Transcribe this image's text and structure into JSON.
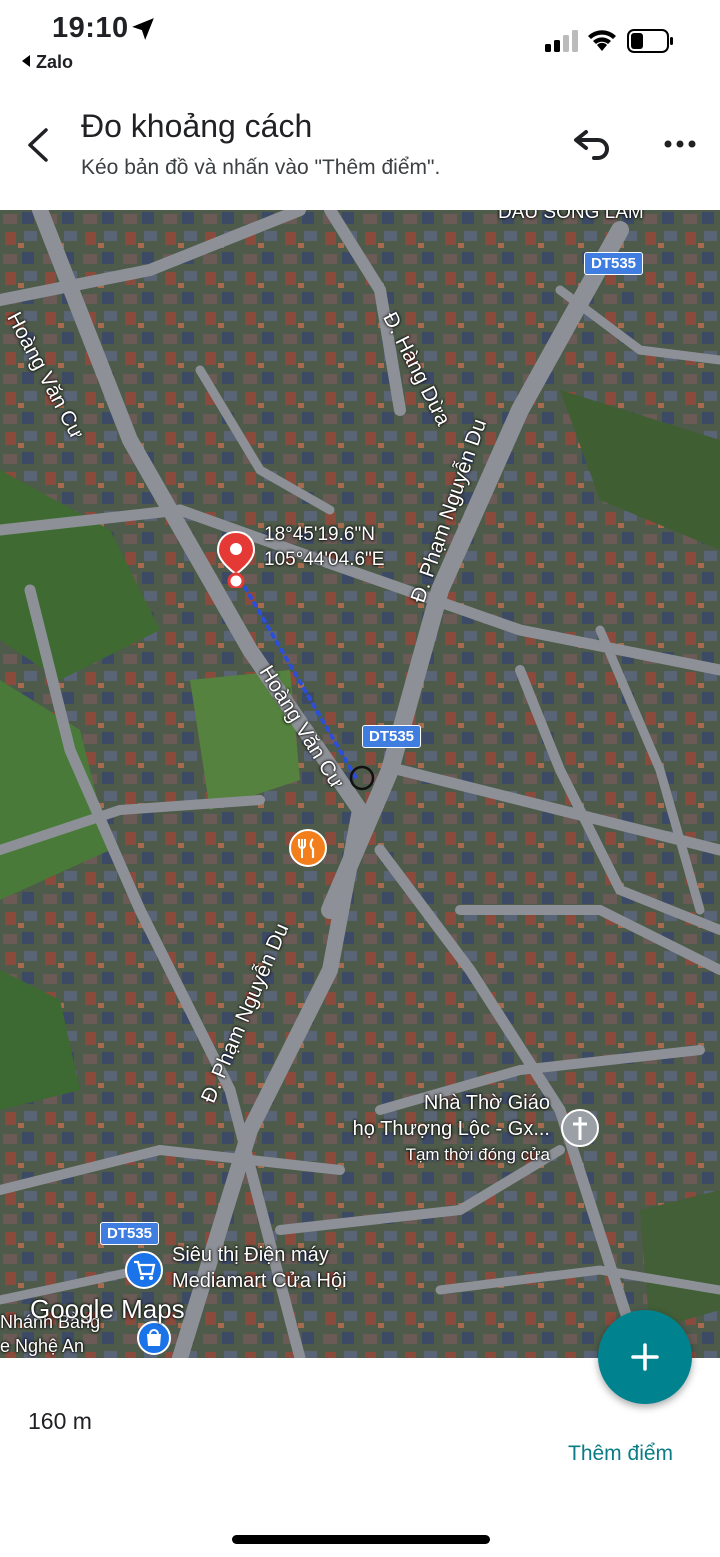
{
  "status_bar": {
    "time": "19:10",
    "back_app": "Zalo"
  },
  "header": {
    "title": "Đo khoảng cách",
    "subtitle": "Kéo bản đồ và nhấn vào \"Thêm điểm\"."
  },
  "map": {
    "road_labels": {
      "hoang_van_cu_top": "Hoàng Văn Cư",
      "hang_dua": "Đ. Hàng Dừa",
      "pham_nguyen_du_top": "Đ. Phạm Nguyễn Du",
      "hoang_van_cu_mid": "Hoàng Văn Cư",
      "pham_nguyen_du_bottom": "Đ. Phạm Nguyễn Du",
      "top_right_partial": "DẦU SÔNG LAM"
    },
    "shields": [
      "DT535",
      "DT535",
      "DT535"
    ],
    "coordinates": {
      "lat": "18°45'19.6\"N",
      "lng": "105°44'04.6\"E"
    },
    "pois": {
      "church_line1": "Nhà Thờ Giáo",
      "church_line2": "họ Thượng Lộc - Gx...",
      "church_status": "Tạm thời đóng cửa",
      "store_line1": "Siêu thị Điện máy",
      "store_line2": "Mediamart Cửa Hội",
      "bottom_left_line1": "Nhánh Bằng",
      "bottom_left_line2": "e Nghệ An"
    },
    "attribution": "Google Maps"
  },
  "panel": {
    "distance": "160 m",
    "add_point_label": "Thêm điểm"
  },
  "colors": {
    "accent": "#00838f",
    "link": "#0b7c86",
    "pin": "#e53935",
    "road": "#8b8f94",
    "shield": "#3f7de0"
  }
}
